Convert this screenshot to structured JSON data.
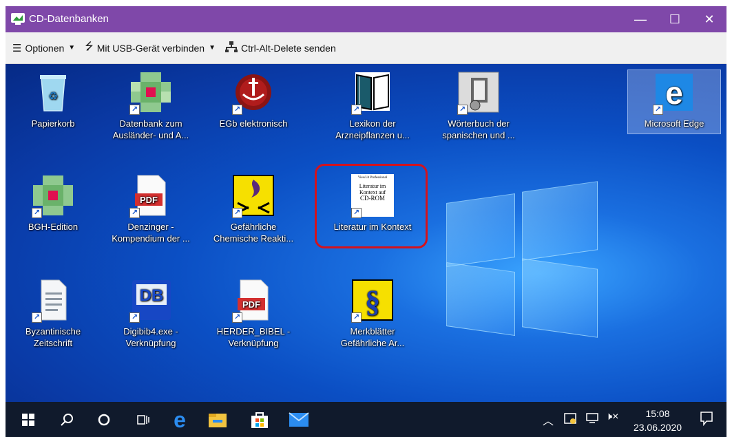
{
  "window": {
    "title": "CD-Datenbanken",
    "controls": {
      "minimize": "—",
      "maximize": "☐",
      "close": "✕"
    }
  },
  "toolbar": {
    "options_label": "Optionen",
    "usb_label": "Mit USB-Gerät verbinden",
    "cad_label": "Ctrl-Alt-Delete senden"
  },
  "desktop": {
    "icons": [
      {
        "label_1": "Papierkorb",
        "label_2": ""
      },
      {
        "label_1": "Datenbank zum",
        "label_2": "Ausländer- und A..."
      },
      {
        "label_1": "EGb elektronisch",
        "label_2": ""
      },
      {
        "label_1": "Lexikon der",
        "label_2": "Arzneipflanzen u..."
      },
      {
        "label_1": "Wörterbuch der",
        "label_2": "spanischen und ..."
      },
      {
        "label_1": "Microsoft Edge",
        "label_2": ""
      },
      {
        "label_1": "BGH-Edition",
        "label_2": ""
      },
      {
        "label_1": "Denzinger -",
        "label_2": "Kompendium der ..."
      },
      {
        "label_1": "Gefährliche",
        "label_2": "Chemische Reakti..."
      },
      {
        "label_1": "Literatur im Kontext",
        "label_2": ""
      },
      {
        "label_1": "Byzantinische",
        "label_2": "Zeitschrift"
      },
      {
        "label_1": "Digibib4.exe -",
        "label_2": "Verknüpfung"
      },
      {
        "label_1": "HERDER_BIBEL -",
        "label_2": "Verknüpfung"
      },
      {
        "label_1": "Merkblätter",
        "label_2": "Gefährliche Ar..."
      }
    ],
    "literatur_thumb": {
      "line1": "ViewLit Professional",
      "line2": "Literatur im",
      "line3": "Kontext auf",
      "line4": "CD-ROM"
    },
    "pdf_text": "PDF",
    "db_text": "DB",
    "paragraph_text": "§"
  },
  "taskbar": {
    "time": "15:08",
    "date": "23.06.2020"
  },
  "colors": {
    "titlebar": "#7f48a9",
    "taskbar": "#101a2c",
    "highlight": "#d4121c"
  }
}
